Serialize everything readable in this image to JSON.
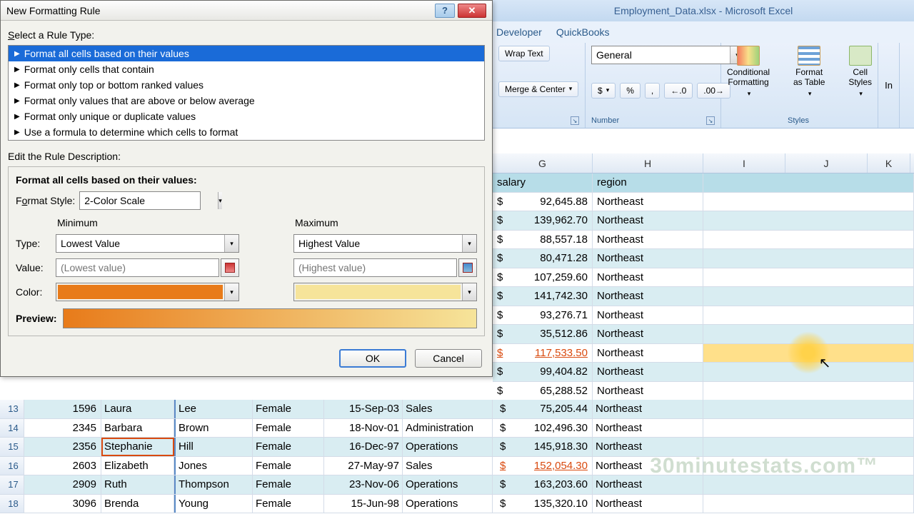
{
  "excel": {
    "title": "Employment_Data.xlsx  -  Microsoft Excel"
  },
  "ribbon": {
    "tabs": [
      "Developer",
      "QuickBooks"
    ],
    "wrap": "Wrap Text",
    "merge": "Merge & Center",
    "number_format": "General",
    "cond_fmt": "Conditional\nFormatting",
    "fmt_table": "Format\nas Table",
    "cell_styles": "Cell\nStyles",
    "group_number": "Number",
    "group_styles": "Styles",
    "currency": "$",
    "percent": "%",
    "comma": ",",
    "inc_dec": ".0",
    "dec_dec": ".00"
  },
  "columns": {
    "G": "G",
    "H": "H",
    "I": "I",
    "J": "J",
    "K": "K"
  },
  "headers": {
    "salary": "salary",
    "region": "region"
  },
  "rows_right": [
    {
      "sal": "92,645.88",
      "reg": "Northeast",
      "band": false
    },
    {
      "sal": "139,962.70",
      "reg": "Northeast",
      "band": true
    },
    {
      "sal": "88,557.18",
      "reg": "Northeast",
      "band": false
    },
    {
      "sal": "80,471.28",
      "reg": "Northeast",
      "band": true
    },
    {
      "sal": "107,259.60",
      "reg": "Northeast",
      "band": false
    },
    {
      "sal": "141,742.30",
      "reg": "Northeast",
      "band": true
    },
    {
      "sal": "93,276.71",
      "reg": "Northeast",
      "band": false
    },
    {
      "sal": "35,512.86",
      "reg": "Northeast",
      "band": true
    },
    {
      "sal": "117,533.50",
      "reg": "Northeast",
      "band": false,
      "red": true
    },
    {
      "sal": "99,404.82",
      "reg": "Northeast",
      "band": true
    },
    {
      "sal": "65,288.52",
      "reg": "Northeast",
      "band": false
    }
  ],
  "rows_full": [
    {
      "n": 13,
      "emp": "1596",
      "first": "Laura",
      "last": "Lee",
      "gender": "Female",
      "date": "15-Sep-03",
      "dept": "Sales",
      "sal": "75,205.44",
      "reg": "Northeast",
      "band": true,
      "sel": false
    },
    {
      "n": 14,
      "emp": "2345",
      "first": "Barbara",
      "last": "Brown",
      "gender": "Female",
      "date": "18-Nov-01",
      "dept": "Administration",
      "sal": "102,496.30",
      "reg": "Northeast",
      "band": false,
      "sel": false
    },
    {
      "n": 15,
      "emp": "2356",
      "first": "Stephanie",
      "last": "Hill",
      "gender": "Female",
      "date": "16-Dec-97",
      "dept": "Operations",
      "sal": "145,918.30",
      "reg": "Northeast",
      "band": true,
      "sel": true
    },
    {
      "n": 16,
      "emp": "2603",
      "first": "Elizabeth",
      "last": "Jones",
      "gender": "Female",
      "date": "27-May-97",
      "dept": "Sales",
      "sal": "152,054.30",
      "reg": "Northeast",
      "band": false,
      "red": true
    },
    {
      "n": 17,
      "emp": "2909",
      "first": "Ruth",
      "last": "Thompson",
      "gender": "Female",
      "date": "23-Nov-06",
      "dept": "Operations",
      "sal": "163,203.60",
      "reg": "Northeast",
      "band": true
    },
    {
      "n": 18,
      "emp": "3096",
      "first": "Brenda",
      "last": "Young",
      "gender": "Female",
      "date": "15-Jun-98",
      "dept": "Operations",
      "sal": "135,320.10",
      "reg": "Northeast",
      "band": false
    }
  ],
  "dialog": {
    "title": "New Formatting Rule",
    "select_label": "Select a Rule Type:",
    "rules": [
      "Format all cells based on their values",
      "Format only cells that contain",
      "Format only top or bottom ranked values",
      "Format only values that are above or below average",
      "Format only unique or duplicate values",
      "Use a formula to determine which cells to format"
    ],
    "edit_label": "Edit the Rule Description:",
    "bold_label": "Format all cells based on their values:",
    "format_style_label": "Format Style:",
    "format_style": "2-Color Scale",
    "min_label": "Minimum",
    "max_label": "Maximum",
    "type_label": "Type:",
    "value_label": "Value:",
    "color_label": "Color:",
    "min_type": "Lowest Value",
    "max_type": "Highest Value",
    "min_value_ph": "(Lowest value)",
    "max_value_ph": "(Highest value)",
    "preview_label": "Preview:",
    "ok": "OK",
    "cancel": "Cancel"
  },
  "watermark": "30minutestats.com™"
}
